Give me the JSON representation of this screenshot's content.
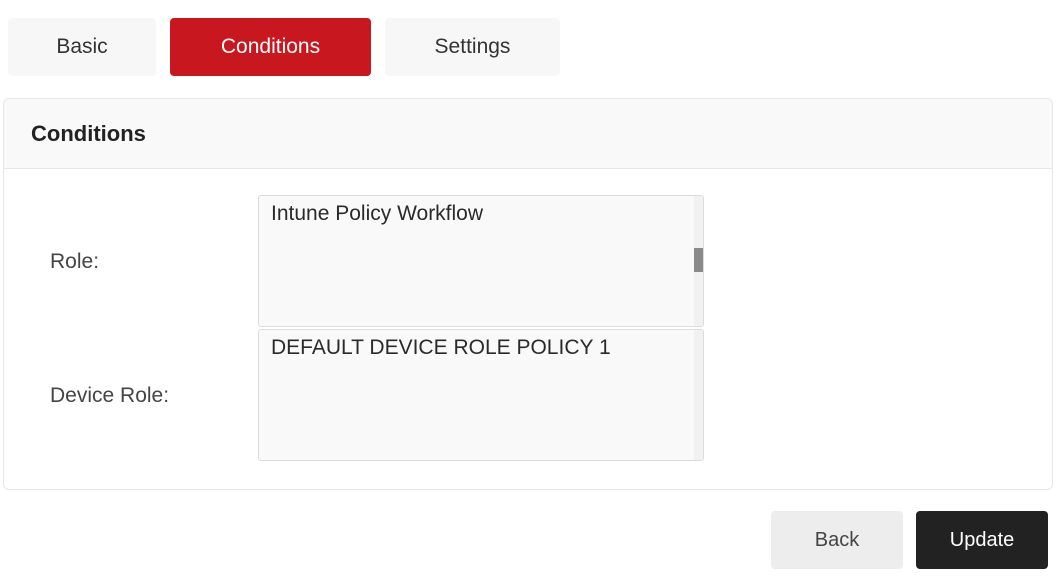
{
  "tabs": {
    "basic": "Basic",
    "conditions": "Conditions",
    "settings": "Settings"
  },
  "panel": {
    "title": "Conditions"
  },
  "fields": {
    "role": {
      "label": "Role:",
      "options": [
        "Intune Policy Workflow"
      ]
    },
    "device_role": {
      "label": "Device Role:",
      "options": [
        "DEFAULT DEVICE ROLE POLICY 1"
      ]
    }
  },
  "actions": {
    "back": "Back",
    "update": "Update"
  },
  "colors": {
    "accent": "#c8171e",
    "primary_button": "#222222"
  }
}
